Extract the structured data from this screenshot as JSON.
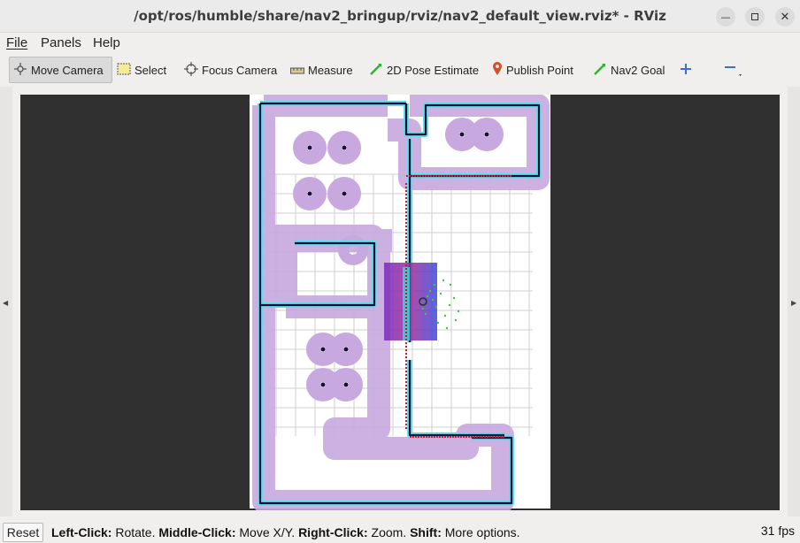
{
  "window": {
    "title": "/opt/ros/humble/share/nav2_bringup/rviz/nav2_default_view.rviz* - RViz"
  },
  "menu": {
    "file": "File",
    "panels": "Panels",
    "help": "Help"
  },
  "toolbar": {
    "move_camera": "Move Camera",
    "select": "Select",
    "focus_camera": "Focus Camera",
    "measure": "Measure",
    "pose_estimate": "2D Pose Estimate",
    "publish_point": "Publish Point",
    "nav2_goal": "Nav2 Goal"
  },
  "status": {
    "reset": "Reset",
    "left_click_key": "Left-Click:",
    "left_click_desc": " Rotate. ",
    "middle_click_key": "Middle-Click:",
    "middle_click_desc": " Move X/Y. ",
    "right_click_key": "Right-Click:",
    "right_click_desc": " Zoom. ",
    "shift_key": "Shift:",
    "shift_desc": " More options.",
    "fps": "31 fps"
  },
  "colors": {
    "viewport_bg": "#303030",
    "costmap_inflation": "#c8a8e0",
    "wall_outline": "#5ee0e8",
    "wall_core": "#1a0a3a",
    "laser": "#e0102a",
    "particles": "#3cc83c",
    "local_costmap": "#6a3ad8"
  },
  "icons": {
    "move_camera": "move-camera-icon",
    "select": "select-icon",
    "focus_camera": "focus-camera-icon",
    "measure": "ruler-icon",
    "pose_estimate": "green-arrow-icon",
    "publish_point": "map-pin-icon",
    "nav2_goal": "green-arrow-icon",
    "add_tool": "plus-icon",
    "remove_tool": "minus-icon"
  }
}
